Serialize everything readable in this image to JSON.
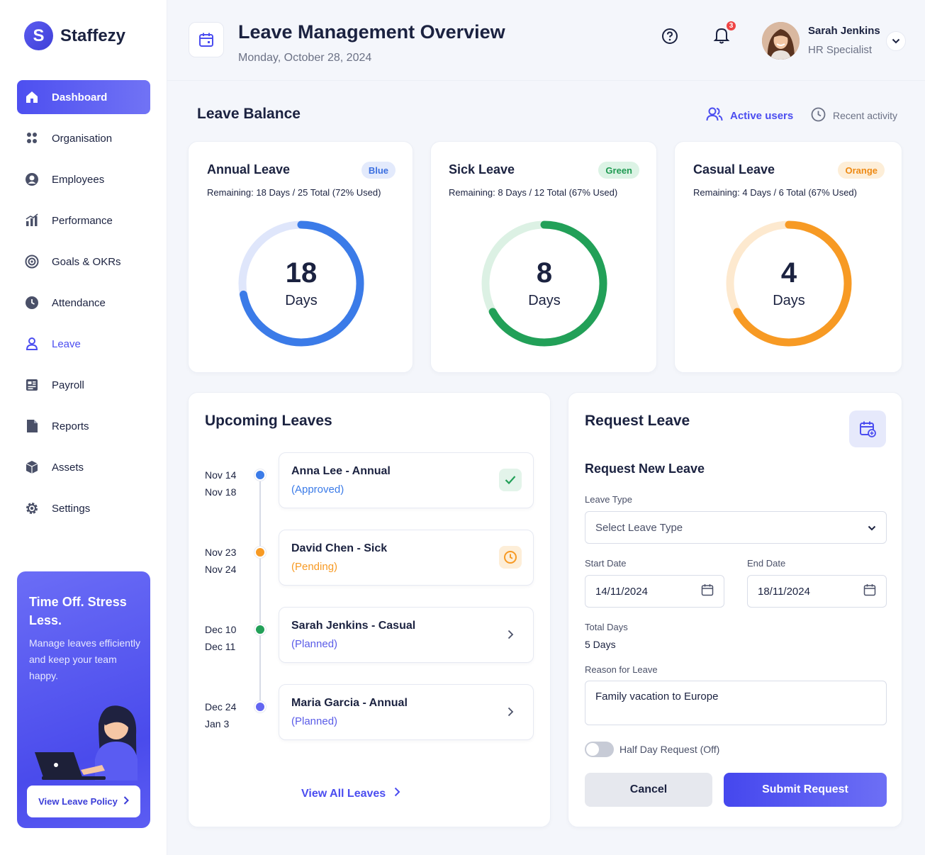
{
  "brand": {
    "initial": "S",
    "name": "Staffezy"
  },
  "sidebar": {
    "items": [
      {
        "label": "Dashboard",
        "icon": "home-icon"
      },
      {
        "label": "Organisation",
        "icon": "org-icon"
      },
      {
        "label": "Employees",
        "icon": "user-circle-icon"
      },
      {
        "label": "Performance",
        "icon": "chart-icon"
      },
      {
        "label": "Goals & OKRs",
        "icon": "target-icon"
      },
      {
        "label": "Attendance",
        "icon": "clock-icon"
      },
      {
        "label": "Leave",
        "icon": "person-icon"
      },
      {
        "label": "Payroll",
        "icon": "payroll-icon"
      },
      {
        "label": "Reports",
        "icon": "file-icon"
      },
      {
        "label": "Assets",
        "icon": "box-icon"
      },
      {
        "label": "Settings",
        "icon": "gear-icon"
      }
    ],
    "promo": {
      "title": "Time Off. Stress Less.",
      "text": "Manage leaves efficiently and keep your team happy.",
      "button": "View Leave Policy"
    }
  },
  "header": {
    "title": "Leave Management Overview",
    "date": "Monday, October 28, 2024",
    "notification_count": "3",
    "user": {
      "name": "Sarah Jenkins",
      "role": "HR Specialist"
    }
  },
  "balance": {
    "title": "Leave Balance",
    "active_users": "Active users",
    "recent_activity": "Recent activity",
    "cards": [
      {
        "title": "Annual Leave",
        "badge": "Blue",
        "subtitle": "Remaining: 18 Days / 25 Total (72% Used)",
        "value": "18",
        "unit": "Days",
        "used_fraction": 0.72,
        "color": "#3b7be8",
        "track": "#dfe6fb",
        "badge_bg": "#e3eafc",
        "badge_fg": "#3b6fe0"
      },
      {
        "title": "Sick Leave",
        "badge": "Green",
        "subtitle": "Remaining: 8 Days / 12 Total (67% Used)",
        "value": "8",
        "unit": "Days",
        "used_fraction": 0.67,
        "color": "#22a058",
        "track": "#dcf1e4",
        "badge_bg": "#dcf3e5",
        "badge_fg": "#1f9a52"
      },
      {
        "title": "Casual Leave",
        "badge": "Orange",
        "subtitle": "Remaining: 4 Days / 6 Total (67% Used)",
        "value": "4",
        "unit": "Days",
        "used_fraction": 0.67,
        "color": "#f79a24",
        "track": "#fde9cf",
        "badge_bg": "#fdeed8",
        "badge_fg": "#ee8a14"
      }
    ]
  },
  "upcoming": {
    "title": "Upcoming Leaves",
    "items": [
      {
        "start": "Nov 14",
        "end": "Nov 18",
        "name": "Anna Lee - Annual",
        "status": "(Approved)",
        "dot": "#3b7be8",
        "status_color": "#3b7be8",
        "icon": "check-icon"
      },
      {
        "start": "Nov 23",
        "end": "Nov 24",
        "name": "David Chen - Sick",
        "status": "(Pending)",
        "dot": "#f79a24",
        "status_color": "#f79a24",
        "icon": "clock-icon"
      },
      {
        "start": "Dec 10",
        "end": "Dec 11",
        "name": "Sarah Jenkins - Casual",
        "status": "(Planned)",
        "dot": "#22a058",
        "status_color": "#5a5ce8",
        "icon": "chevron-right-icon"
      },
      {
        "start": "Dec 24",
        "end": "Jan 3",
        "name": "Maria Garcia - Annual",
        "status": "(Planned)",
        "dot": "#6366f1",
        "status_color": "#5a5ce8",
        "icon": "chevron-right-icon"
      }
    ],
    "view_all": "View All Leaves"
  },
  "request": {
    "title": "Request Leave",
    "subtitle": "Request New Leave",
    "leave_type_label": "Leave Type",
    "leave_type_placeholder": "Select Leave Type",
    "start_label": "Start Date",
    "start_value": "14/11/2024",
    "end_label": "End Date",
    "end_value": "18/11/2024",
    "total_label": "Total Days",
    "total_value": "5 Days",
    "reason_label": "Reason for Leave",
    "reason_value": "Family vacation to Europe",
    "half_day_label": "Half Day Request (Off)",
    "cancel": "Cancel",
    "submit": "Submit Request"
  }
}
